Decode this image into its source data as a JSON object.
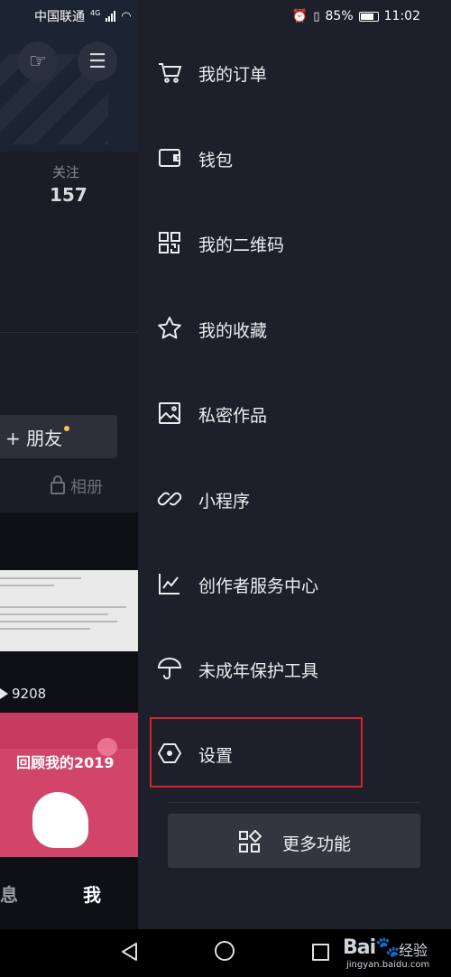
{
  "status_bar": {
    "carrier": "中国联通",
    "network": "4G",
    "battery": "85%",
    "time": "11:02"
  },
  "background_profile": {
    "stat_label": "关注",
    "stat_value": "157",
    "friend_button": "+ 朋友",
    "album_label": "相册",
    "video_views": "9208",
    "thumbnail_text": "回顾我的2019",
    "tab_left": "息",
    "tab_me": "我"
  },
  "drawer": {
    "items": [
      {
        "label": "我的订单",
        "icon": "cart-icon"
      },
      {
        "label": "钱包",
        "icon": "wallet-icon"
      },
      {
        "label": "我的二维码",
        "icon": "qr-code-icon"
      },
      {
        "label": "我的收藏",
        "icon": "star-icon"
      },
      {
        "label": "私密作品",
        "icon": "image-icon"
      },
      {
        "label": "小程序",
        "icon": "link-icon"
      },
      {
        "label": "创作者服务中心",
        "icon": "chart-icon"
      },
      {
        "label": "未成年保护工具",
        "icon": "umbrella-icon"
      },
      {
        "label": "设置",
        "icon": "settings-hexagon-icon"
      }
    ],
    "more_button": "更多功能"
  },
  "watermark": {
    "brand": "Bai",
    "brand_suffix": "经验",
    "url": "jingyan.baidu.com"
  },
  "colors": {
    "drawer_bg": "#1d1f2b",
    "highlight_border": "#d6232b",
    "notification_dot": "#f5c44a"
  }
}
